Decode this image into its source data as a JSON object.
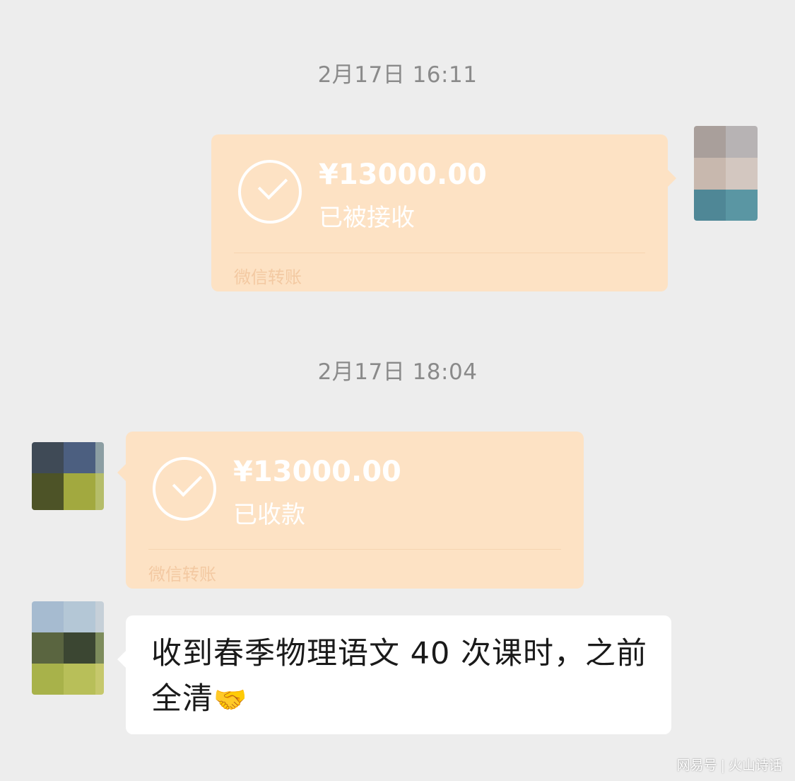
{
  "timestamps": [
    "2月17日 16:11",
    "2月17日 18:04"
  ],
  "transfer_sent": {
    "amount": "¥13000.00",
    "status": "已被接收",
    "brand": "微信转账"
  },
  "transfer_received": {
    "amount": "¥13000.00",
    "status": "已收款",
    "brand": "微信转账"
  },
  "text_message": {
    "text": "收到春季物理语文 40 次课时，之前全清",
    "emoji": "🤝"
  },
  "watermark": {
    "source": "网易号",
    "author": "火山诗话"
  },
  "colors": {
    "background": "#ededed",
    "transfer_bubble": "#fde2c4",
    "text_bubble": "#ffffff",
    "timestamp_text": "#8a8a8a"
  },
  "icons": {
    "transfer_status": "check-circle-icon",
    "avatar": "pixelated-avatar"
  }
}
